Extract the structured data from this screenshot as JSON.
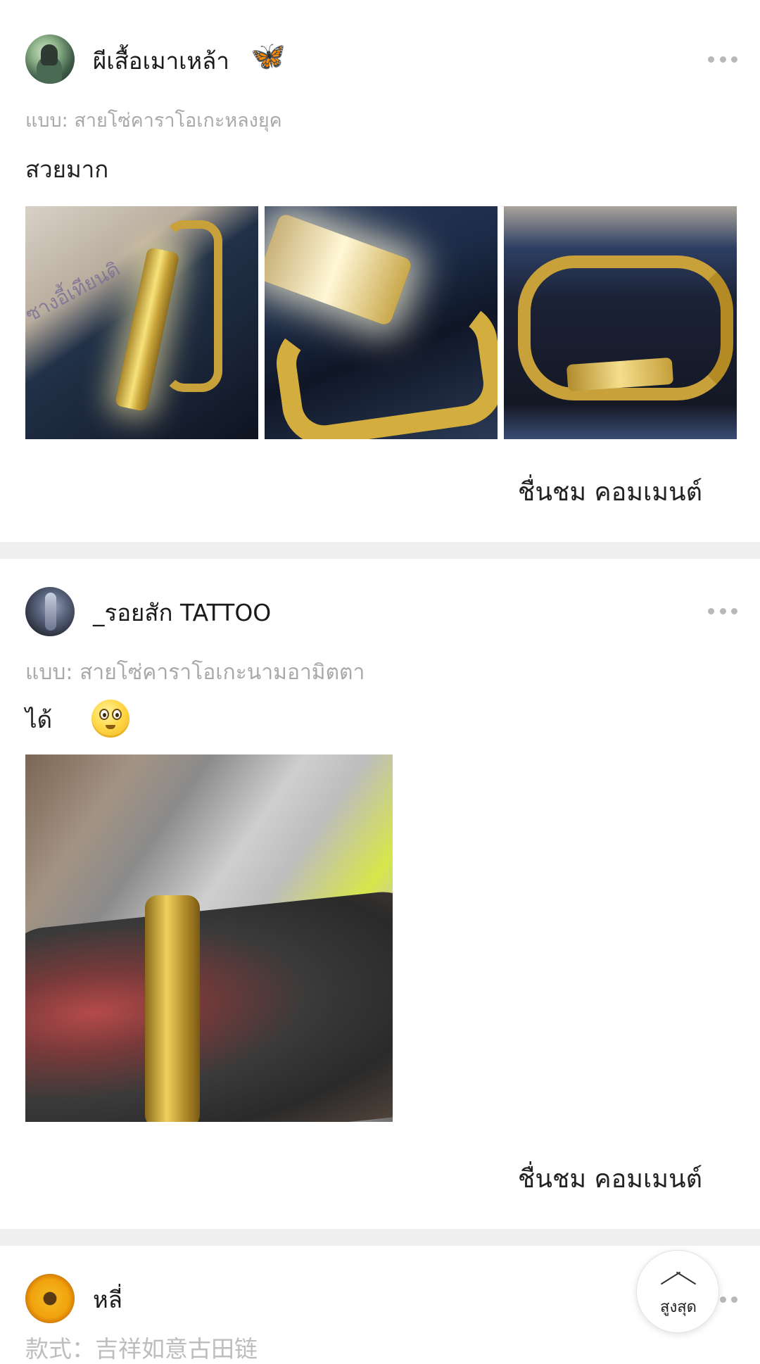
{
  "posts": [
    {
      "username": "ผีเสื้อเมาเหล้า",
      "variant": "แบบ: สายโซ่คาราโอเกะหลงยุค",
      "comment": "สวยมาก",
      "photo_watermark": "ซางอี้เทียนดิ",
      "action": "ชื่นชม คอมเมนต์"
    },
    {
      "username": "_รอยสัก TATTOO",
      "variant": "แบบ: สายโซ่คาราโอเกะนามอามิตตา",
      "comment": "ได้",
      "action": "ชื่นชม คอมเมนต์"
    },
    {
      "username": "หลี่",
      "variant_partial": "款式：吉祥如意古田链"
    }
  ],
  "back_to_top": {
    "label": "สูงสุด"
  },
  "icons": {
    "more": "more-dots-icon",
    "butterfly": "butterfly-icon",
    "smiley": "smiley-icon",
    "back_to_top": "chevron-up-icon"
  },
  "colors": {
    "separator": "#efefef",
    "secondary_text": "#a9a9a9",
    "more_dots": "#b8b8b8"
  }
}
